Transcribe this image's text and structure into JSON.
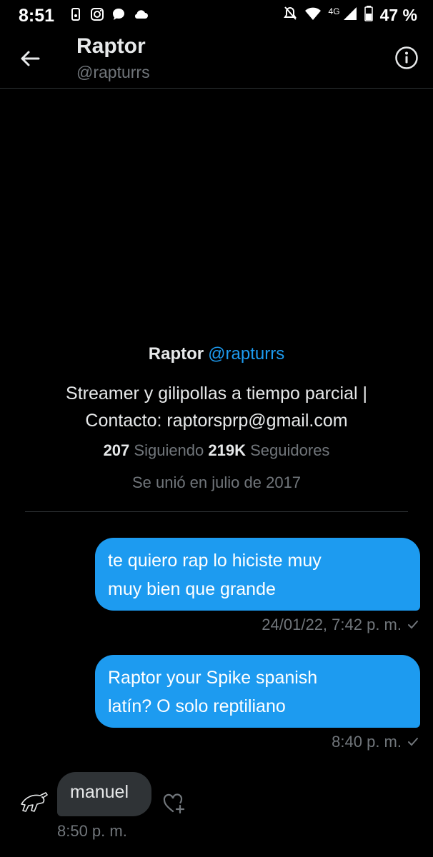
{
  "status_bar": {
    "time": "8:51",
    "network": "4G",
    "battery": "47 %",
    "left_icons": [
      "phone-sync-icon",
      "instagram-icon",
      "chat-bubble-icon",
      "cloud-icon"
    ],
    "right_icons": [
      "mute-icon",
      "wifi-icon",
      "signal-icon",
      "battery-icon"
    ]
  },
  "header": {
    "name": "Raptor",
    "handle": "@rapturrs",
    "back_icon": "arrow-left-icon",
    "info_icon": "info-icon"
  },
  "profile": {
    "name": "Raptor",
    "handle": "@rapturrs",
    "bio_line1": "Streamer y gilipollas a tiempo parcial |",
    "bio_line2": "Contacto: raptorsprp@gmail.com",
    "following_count": "207",
    "following_label": "Siguiendo",
    "followers_count": "219K",
    "followers_label": "Seguidores",
    "joined": "Se unió en julio de 2017"
  },
  "messages": [
    {
      "direction": "out",
      "line1": "te quiero rap lo hiciste muy",
      "line2": "muy bien que grande",
      "timestamp": "24/01/22, 7:42 p. m.",
      "status_icon": "check-icon"
    },
    {
      "direction": "out",
      "line1": "Raptor your Spike spanish",
      "line2": "latín? O solo reptiliano",
      "timestamp": "8:40 p. m.",
      "status_icon": "check-icon"
    },
    {
      "direction": "in",
      "text": "manuel",
      "timestamp": "8:50 p. m.",
      "reaction_icon": "add-reaction-heart-icon"
    }
  ],
  "colors": {
    "background": "#000000",
    "accent": "#1d9bf0",
    "incoming_bubble": "#2f3336",
    "muted_text": "#71767b"
  }
}
